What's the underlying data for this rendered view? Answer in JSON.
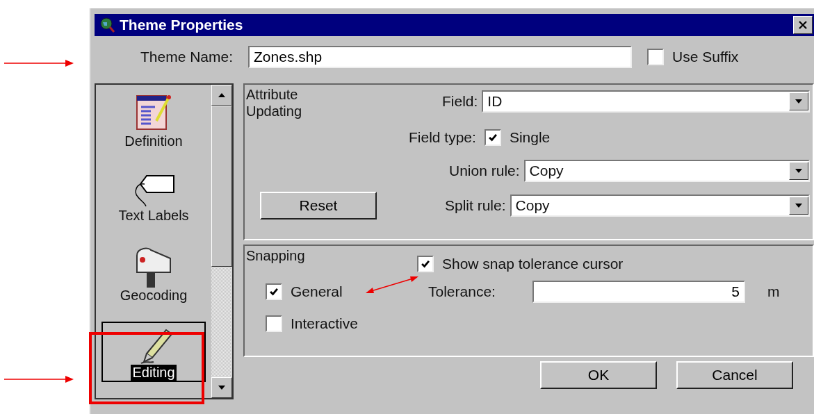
{
  "window": {
    "title": "Theme Properties"
  },
  "theme_name": {
    "label": "Theme Name:",
    "value": "Zones.shp"
  },
  "use_suffix": {
    "label": "Use Suffix",
    "checked": false
  },
  "sidebar": {
    "items": [
      {
        "label": "Definition",
        "kind": "definition",
        "selected": false
      },
      {
        "label": "Text Labels",
        "kind": "labels",
        "selected": false
      },
      {
        "label": "Geocoding",
        "kind": "geocoding",
        "selected": false
      },
      {
        "label": "Editing",
        "kind": "editing",
        "selected": true
      }
    ]
  },
  "attribute_updating": {
    "title": "Attribute Updating",
    "field": {
      "label": "Field:",
      "value": "ID"
    },
    "field_type": {
      "label": "Field type:",
      "option": "Single",
      "checked": true
    },
    "union_rule": {
      "label": "Union rule:",
      "value": "Copy"
    },
    "split_rule": {
      "label": "Split rule:",
      "value": "Copy"
    },
    "reset_button": "Reset"
  },
  "snapping": {
    "title": "Snapping",
    "show_cursor": {
      "label": "Show snap tolerance cursor",
      "checked": true
    },
    "general": {
      "label": "General",
      "checked": true
    },
    "interactive": {
      "label": "Interactive",
      "checked": false
    },
    "tolerance": {
      "label": "Tolerance:",
      "value": "5",
      "unit": "m"
    }
  },
  "buttons": [
    "OK",
    "Cancel"
  ]
}
